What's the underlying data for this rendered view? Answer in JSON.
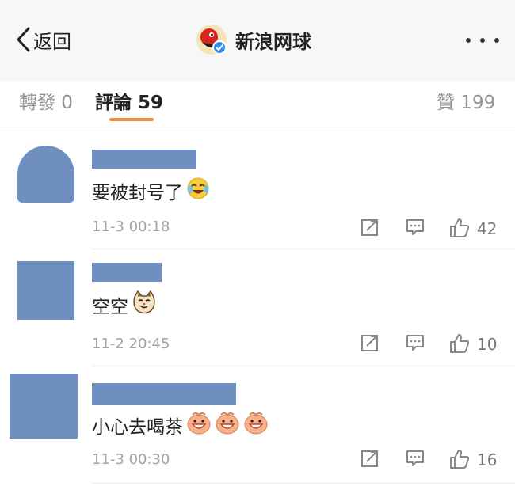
{
  "nav": {
    "back_label": "返回",
    "title": "新浪网球"
  },
  "tabs": {
    "repost": "轉發 0",
    "comments": "評論 59",
    "likes": "贊 199"
  },
  "comments": [
    {
      "text": "要被封号了",
      "emoji": [
        "laugh-cry-emoji"
      ],
      "time": "11-3 00:18",
      "likes": "42"
    },
    {
      "text": "空空",
      "emoji": [
        "cat-face-emoji"
      ],
      "time": "11-2 20:45",
      "likes": "10"
    },
    {
      "text": "小心去喝茶",
      "emoji": [
        "grin-face-emoji",
        "grin-face-emoji",
        "grin-face-emoji"
      ],
      "time": "11-3 00:30",
      "likes": "16"
    }
  ],
  "colors": {
    "accent": "#f28e3d",
    "redaction": "#6e8fbf",
    "muted": "#a3a3a3"
  },
  "icons": [
    "chevron-left-icon",
    "sina-logo-icon",
    "more-icon",
    "repost-icon",
    "reply-icon",
    "thumbs-up-icon"
  ]
}
